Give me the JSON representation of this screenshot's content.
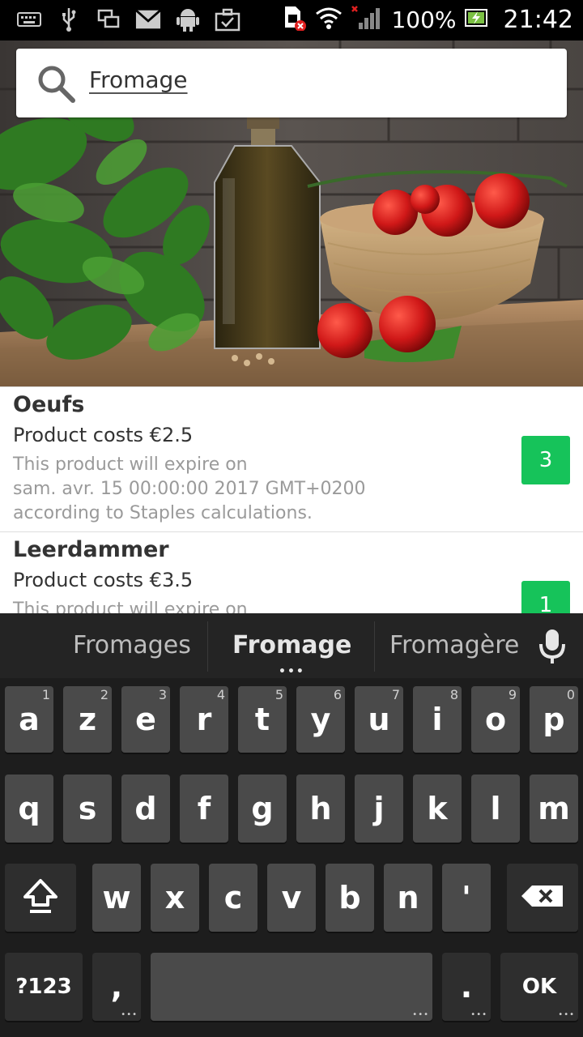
{
  "status_bar": {
    "left_icons": [
      "keyboard-icon",
      "usb-icon",
      "screen-mirror-icon",
      "gmail-icon",
      "android-icon",
      "briefcase-icon"
    ],
    "right_icons": [
      "sim-card-icon",
      "wifi-icon",
      "signal-icon",
      "battery-icon"
    ],
    "battery": "100%",
    "time": "21:42"
  },
  "search": {
    "icon": "search-icon",
    "value": "Fromage"
  },
  "products": [
    {
      "name": "Oeufs",
      "cost": "Product costs €2.5",
      "expire_line1": "This product will expire on",
      "expire_line2": "sam. avr. 15 00:00:00 2017 GMT+0200",
      "expire_line3": "according to Staples calculations.",
      "quantity": "3"
    },
    {
      "name": "Leerdammer",
      "cost": "Product costs €3.5",
      "expire_line1": "This product will expire on",
      "expire_line2": "",
      "expire_line3": "",
      "quantity": "1"
    }
  ],
  "keyboard": {
    "suggestions": [
      "Fromages",
      "Fromage",
      "Fromagère"
    ],
    "row1": [
      {
        "k": "a",
        "n": "1"
      },
      {
        "k": "z",
        "n": "2"
      },
      {
        "k": "e",
        "n": "3"
      },
      {
        "k": "r",
        "n": "4"
      },
      {
        "k": "t",
        "n": "5"
      },
      {
        "k": "y",
        "n": "6"
      },
      {
        "k": "u",
        "n": "7"
      },
      {
        "k": "i",
        "n": "8"
      },
      {
        "k": "o",
        "n": "9"
      },
      {
        "k": "p",
        "n": "0"
      }
    ],
    "row2": [
      "q",
      "s",
      "d",
      "f",
      "g",
      "h",
      "j",
      "k",
      "l",
      "m"
    ],
    "row3": [
      "w",
      "x",
      "c",
      "v",
      "b",
      "n",
      "'"
    ],
    "symbols": "?123",
    "comma": ",",
    "period": ".",
    "ok": "OK"
  },
  "colors": {
    "badge_green": "#16c35a",
    "key_bg": "#4a4a4a",
    "keyboard_bg": "#1d1d1d"
  }
}
